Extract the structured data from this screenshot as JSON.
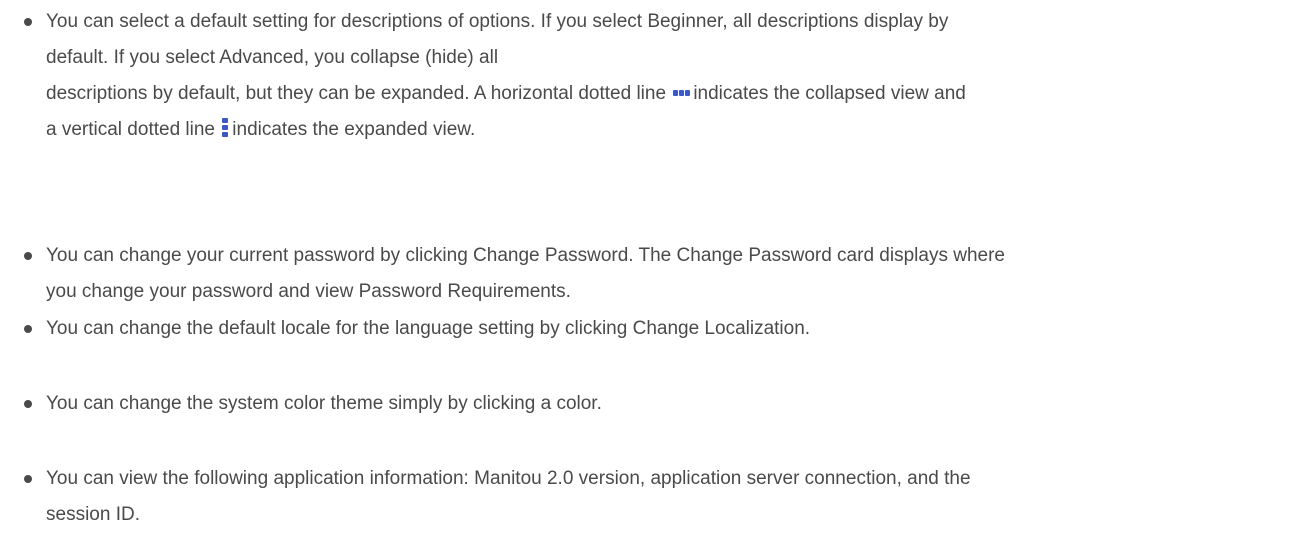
{
  "items": [
    {
      "lines": [
        "You can select a default setting for descriptions of options. If you select Beginner, all descriptions display by",
        "default. If you select Advanced, you collapse (hide) all",
        "descriptions by default, but they can be expanded. A horizontal dotted line",
        "indicates the collapsed view and",
        "a vertical dotted line",
        "indicates the expanded view."
      ],
      "icons": [
        "horizontal-dotted-line-icon",
        "vertical-dotted-line-icon"
      ]
    },
    {
      "lines": [
        "You can change your current password by clicking Change Password. The Change Password card displays where",
        "you change your password and view Password Requirements."
      ]
    },
    {
      "lines": [
        "You can change the default locale for the language setting by clicking Change Localization."
      ]
    },
    {
      "lines": [
        "You can change the system color theme simply by clicking a color."
      ]
    },
    {
      "lines": [
        "You can view the following application information: Manitou 2.0 version, application server connection, and the",
        "session ID."
      ]
    }
  ],
  "colors": {
    "text": "#4a4a4a",
    "icon_accent": "#3b58c4"
  }
}
